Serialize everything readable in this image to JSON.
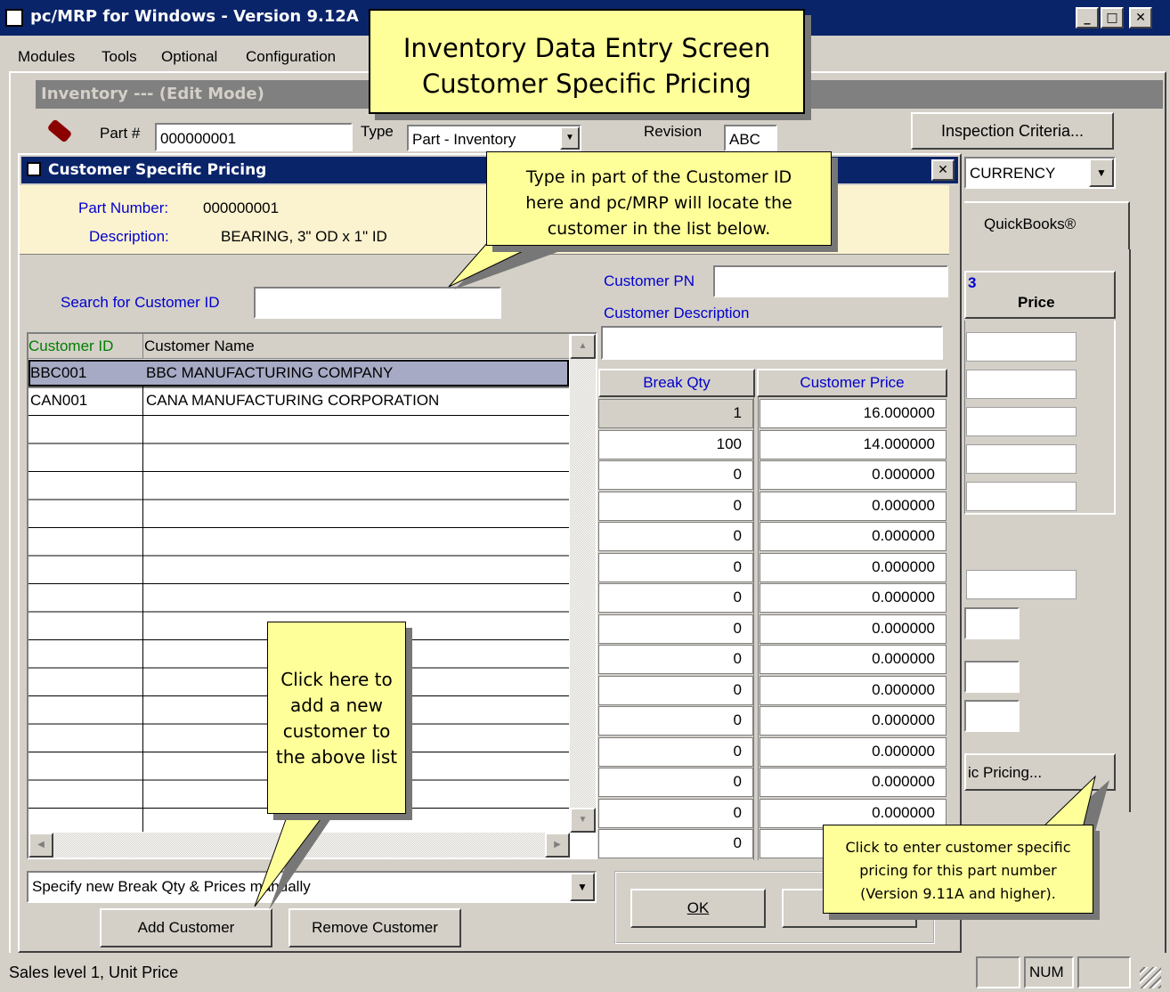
{
  "main_window": {
    "title": "pc/MRP for Windows - Version 9.12A",
    "menu": [
      "Modules",
      "Tools",
      "Optional",
      "Configuration"
    ],
    "inventory_title": "Inventory --- (Edit Mode)",
    "part_label": "Part #",
    "part_value": "000000001",
    "type_label": "Type",
    "type_value": "Part - Inventory",
    "revision_label": "Revision",
    "revision_value": "ABC",
    "inspection_button": "Inspection Criteria...",
    "currency_value": "CURRENCY",
    "quickbooks_tab": "QuickBooks®",
    "price_header": "Price",
    "price_header_prefix": "3",
    "specific_pricing_button": "ic Pricing...",
    "status_text": "Sales level 1, Unit Price",
    "status_num": "NUM"
  },
  "dialog": {
    "title": "Customer Specific Pricing",
    "part_number_label": "Part Number:",
    "part_number_value": "000000001",
    "description_label": "Description:",
    "description_value": "BEARING, 3\" OD x 1\" ID",
    "search_label": "Search for Customer ID",
    "search_value": "",
    "customer_pn_label": "Customer PN",
    "customer_pn_value": "",
    "customer_desc_label": "Customer Description",
    "customer_desc_value": "",
    "table": {
      "columns": [
        "Customer ID",
        "Customer Name"
      ],
      "rows": [
        {
          "id": "BBC001",
          "name": "BBC MANUFACTURING COMPANY",
          "selected": true
        },
        {
          "id": "CAN001",
          "name": "CANA MANUFACTURING CORPORATION",
          "selected": false
        }
      ]
    },
    "break_table": {
      "columns": [
        "Break Qty",
        "Customer Price"
      ],
      "rows": [
        {
          "qty": "1",
          "price": "16.000000"
        },
        {
          "qty": "100",
          "price": "14.000000"
        },
        {
          "qty": "0",
          "price": "0.000000"
        },
        {
          "qty": "0",
          "price": "0.000000"
        },
        {
          "qty": "0",
          "price": "0.000000"
        },
        {
          "qty": "0",
          "price": "0.000000"
        },
        {
          "qty": "0",
          "price": "0.000000"
        },
        {
          "qty": "0",
          "price": "0.000000"
        },
        {
          "qty": "0",
          "price": "0.000000"
        },
        {
          "qty": "0",
          "price": "0.000000"
        },
        {
          "qty": "0",
          "price": "0.000000"
        },
        {
          "qty": "0",
          "price": "0.000000"
        },
        {
          "qty": "0",
          "price": "0.000000"
        },
        {
          "qty": "0",
          "price": "0.000000"
        },
        {
          "qty": "0",
          "price": ""
        }
      ]
    },
    "mode_select": "Specify new Break Qty & Prices manually",
    "add_button": "Add Customer",
    "remove_button": "Remove Customer",
    "ok_button": "OK"
  },
  "callouts": {
    "title_line1": "Inventory Data Entry Screen",
    "title_line2": "Customer Specific Pricing",
    "search_line1": "Type in part of the Customer ID",
    "search_line2": "here and pc/MRP will locate the",
    "search_line3": "customer in the list below.",
    "add_line1": "Click here to",
    "add_line2": "add a new",
    "add_line3": "customer to",
    "add_line4": "the above list",
    "pricing_line1": "Click to enter customer specific",
    "pricing_line2": "pricing for this part number",
    "pricing_line3": "(Version 9.11A and higher)."
  }
}
